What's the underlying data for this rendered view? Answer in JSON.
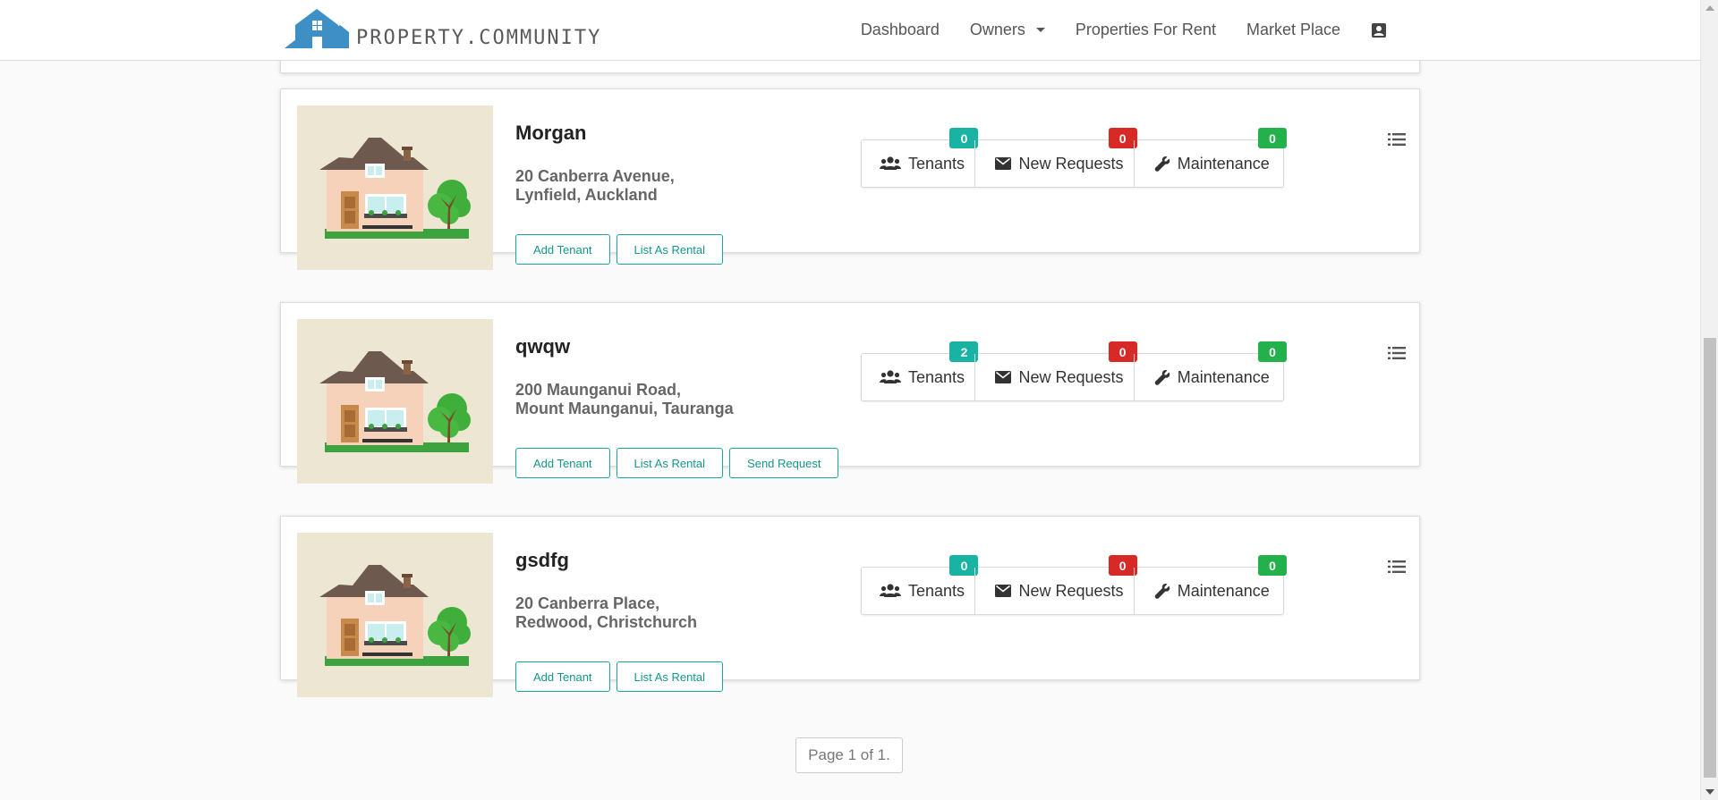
{
  "brand": {
    "logo_text": "PROPERTY.COMMUNITY"
  },
  "nav": {
    "dashboard": "Dashboard",
    "owners": "Owners",
    "properties_for_rent": "Properties For Rent",
    "market_place": "Market Place",
    "user_icon": "contact-card-icon"
  },
  "stat_labels": {
    "tenants": "Tenants",
    "requests": "New Requests",
    "maintenance": "Maintenance"
  },
  "colors": {
    "accent": "#14978b",
    "badge_teal": "#19b3a3",
    "badge_red": "#d72a26",
    "badge_green": "#24b14b"
  },
  "properties": [
    {
      "name": "Morgan",
      "address": [
        "20 Canberra Avenue,",
        "Lynfield, Auckland"
      ],
      "tenants": "0",
      "new_requests": "0",
      "maintenance": "0",
      "actions": [
        "Add Tenant",
        "List As Rental"
      ]
    },
    {
      "name": "qwqw",
      "address": [
        "200 Maunganui Road,",
        "Mount Maunganui, Tauranga"
      ],
      "tenants": "2",
      "new_requests": "0",
      "maintenance": "0",
      "actions": [
        "Add Tenant",
        "List As Rental",
        "Send Request"
      ]
    },
    {
      "name": "gsdfg",
      "address": [
        "20 Canberra Place,",
        "Redwood, Christchurch"
      ],
      "tenants": "0",
      "new_requests": "0",
      "maintenance": "0",
      "actions": [
        "Add Tenant",
        "List As Rental"
      ]
    }
  ],
  "pagination": {
    "text": "Page 1 of 1."
  }
}
